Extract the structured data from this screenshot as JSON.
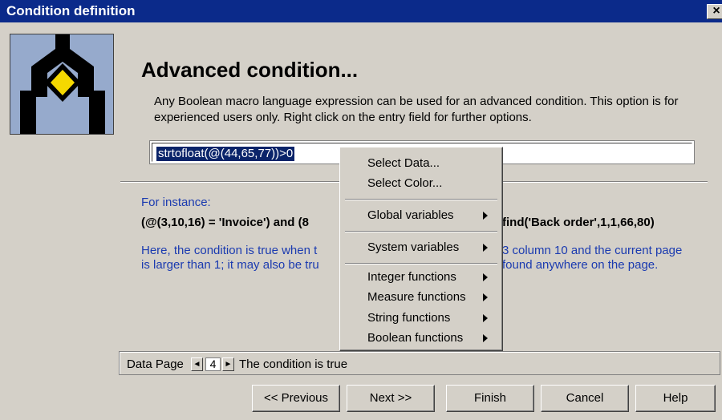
{
  "window": {
    "title": "Condition definition",
    "close_glyph": "×"
  },
  "heading": "Advanced condition...",
  "description": "Any Boolean macro language expression can be used for an advanced condition. This option is for experienced users only. Right click on the entry field for further options.",
  "expression": {
    "value": "strtofloat(@(44,65,77))>0"
  },
  "example": {
    "label": "For instance:",
    "expression": "(@(3,10,16) = 'Invoice') and (8",
    "expression_tail": "find('Back order',1,1,66,80)",
    "explanation_line1_left": "Here, the condition is true when t",
    "explanation_line1_right": "3 column 10 and the current page",
    "explanation_line2_left": "is larger than 1; it may also be tru",
    "explanation_line2_right": "found anywhere on the page."
  },
  "status": {
    "data_page_label": "Data Page",
    "page_number": "4",
    "condition_text": "The condition is true",
    "prev_arrow": "◄",
    "next_arrow": "►"
  },
  "buttons": {
    "previous": "<< Previous",
    "next": "Next >>",
    "finish": "Finish",
    "cancel": "Cancel",
    "help": "Help"
  },
  "context_menu": {
    "items": [
      {
        "label": "Select Data...",
        "submenu": false
      },
      {
        "label": "Select Color...",
        "submenu": false
      },
      {
        "label": "Global variables",
        "submenu": true
      },
      {
        "label": "System variables",
        "submenu": true
      },
      {
        "label": "Integer functions",
        "submenu": true
      },
      {
        "label": "Measure functions",
        "submenu": true
      },
      {
        "label": "String functions",
        "submenu": true
      },
      {
        "label": "Boolean functions",
        "submenu": true
      }
    ]
  },
  "colors": {
    "titlebar": "#0b2a8a",
    "link_text": "#1b3bb0",
    "logo_bg": "#96aacc",
    "logo_diamond": "#f5d800"
  }
}
